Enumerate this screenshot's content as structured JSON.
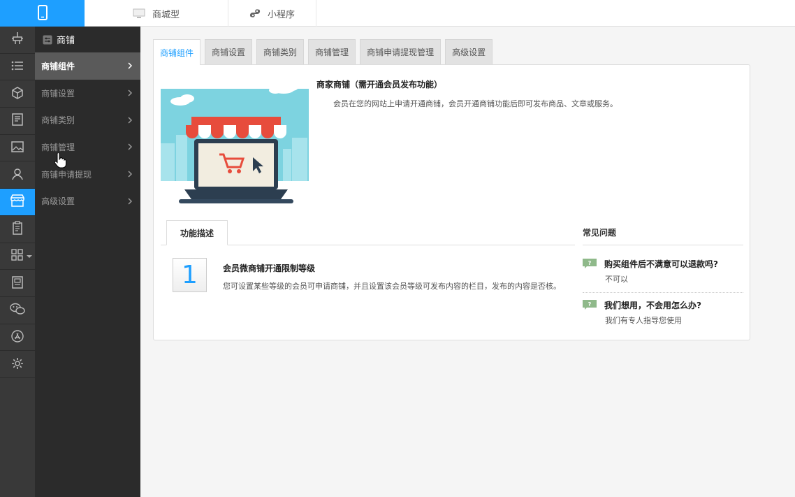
{
  "topbar": {
    "tabs": [
      {
        "label": "商城型",
        "icon": "monitor-icon"
      },
      {
        "label": "小程序",
        "icon": "mini-program-icon"
      }
    ],
    "logo_icon": "phone-icon"
  },
  "rail": {
    "items": [
      {
        "icon": "plugin-icon"
      },
      {
        "icon": "list-icon"
      },
      {
        "icon": "cube-icon"
      },
      {
        "icon": "document-icon"
      },
      {
        "icon": "image-icon"
      },
      {
        "icon": "user-icon"
      },
      {
        "icon": "store-icon",
        "active": true
      },
      {
        "icon": "clipboard-icon"
      },
      {
        "icon": "apps-grid-icon"
      },
      {
        "icon": "article-icon"
      },
      {
        "icon": "wechat-icon"
      },
      {
        "icon": "app-store-icon"
      },
      {
        "icon": "settings-gear-icon"
      }
    ]
  },
  "submenu": {
    "title": "商铺",
    "items": [
      {
        "label": "商铺组件",
        "active": true
      },
      {
        "label": "商铺设置"
      },
      {
        "label": "商铺类别"
      },
      {
        "label": "商铺管理"
      },
      {
        "label": "商铺申请提现"
      },
      {
        "label": "高级设置"
      }
    ]
  },
  "tabs": [
    {
      "label": "商铺组件",
      "active": true
    },
    {
      "label": "商铺设置"
    },
    {
      "label": "商铺类别"
    },
    {
      "label": "商铺管理"
    },
    {
      "label": "商铺申请提现管理"
    },
    {
      "label": "高级设置"
    }
  ],
  "hero": {
    "title": "商家商铺（需开通会员发布功能）",
    "description": "会员在您的网站上申请开通商铺，会员开通商铺功能后即可发布商品、文章或服务。"
  },
  "feature": {
    "tab_label": "功能描述",
    "number": "1",
    "title": "会员微商铺开通限制等级",
    "description": "您可设置某些等级的会员可申请商铺，并且设置该会员等级可发布内容的栏目，发布的内容是否核。"
  },
  "faq": {
    "title": "常见问题",
    "items": [
      {
        "question": "购买组件后不满意可以退款吗?",
        "answer": "不可以"
      },
      {
        "question": "我们想用，不会用怎么办?",
        "answer": "我们有专人指导您使用"
      }
    ]
  },
  "colors": {
    "accent": "#1e9fff",
    "rail_bg": "#393939",
    "submenu_bg": "#2b2b2b",
    "submenu_active": "#5a5a5a",
    "faq_badge": "#8fb98a"
  }
}
